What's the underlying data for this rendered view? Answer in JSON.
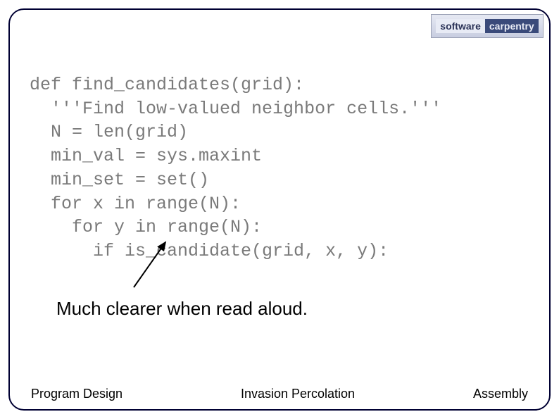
{
  "logo": {
    "left": "software",
    "right": "carpentry"
  },
  "code": {
    "line1": "def find_candidates(grid):",
    "line2": "  '''Find low-valued neighbor cells.'''",
    "line3": "  N = len(grid)",
    "line4": "  min_val = sys.maxint",
    "line5": "  min_set = set()",
    "line6": "  for x in range(N):",
    "line7": "    for y in range(N):",
    "line8": "      if is_candidate(grid, x, y):"
  },
  "caption": "Much clearer when read aloud.",
  "footer": {
    "left": "Program Design",
    "center": "Invasion Percolation",
    "right": "Assembly"
  }
}
